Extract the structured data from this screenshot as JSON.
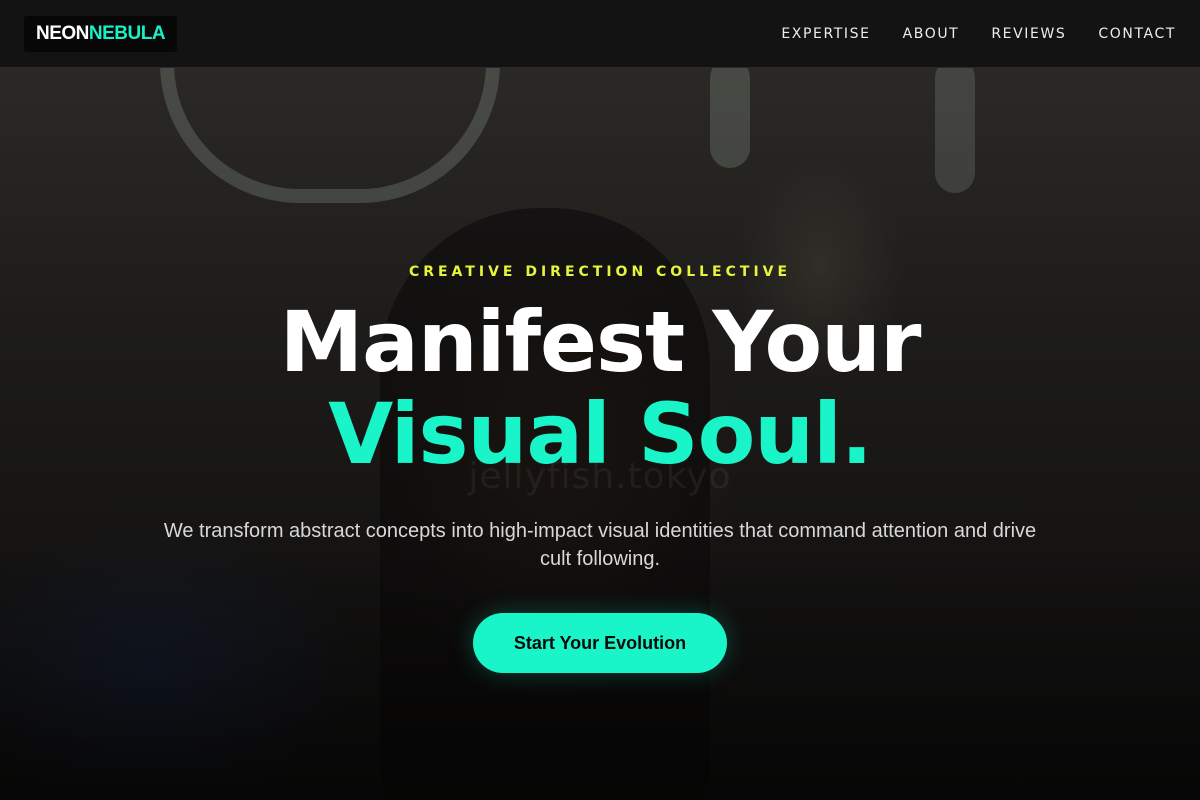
{
  "brand": {
    "logo_part1": "NEON",
    "logo_part2": "NEBULA",
    "accent": "#19f5c8",
    "highlight": "#e6f43a"
  },
  "nav": {
    "items": [
      {
        "label": "EXPERTISE"
      },
      {
        "label": "ABOUT"
      },
      {
        "label": "REVIEWS"
      },
      {
        "label": "CONTACT"
      }
    ]
  },
  "hero": {
    "eyebrow": "CREATIVE DIRECTION COLLECTIVE",
    "headline_line1": "Manifest Your",
    "headline_line2": "Visual Soul.",
    "subtext": "We transform abstract concepts into high-impact visual identities that command attention and drive cult following.",
    "cta_label": "Start Your Evolution",
    "watermark": "jellyfish.tokyo"
  }
}
